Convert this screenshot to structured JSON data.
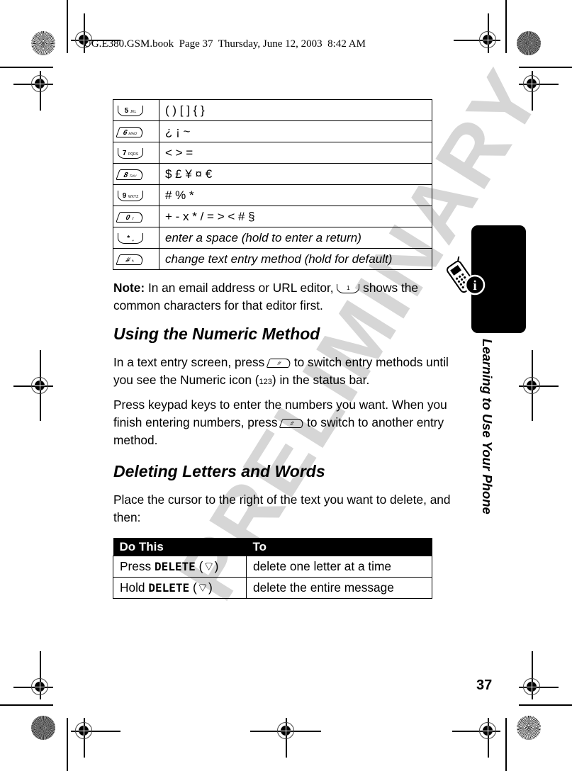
{
  "book_header": "UG.E380.GSM.book  Page 37  Thursday, June 12, 2003  8:42 AM",
  "watermark": "PRELIMINARY",
  "symbol_table": {
    "rows": [
      {
        "key_icon": "key-5-jkl-icon",
        "key_label": "5",
        "key_sub": "JKL",
        "value": "( ) [ ] { }",
        "italic": false
      },
      {
        "key_icon": "key-6-mno-icon",
        "key_label": "6",
        "key_sub": "MNO",
        "value": "¿ ¡ ~",
        "italic": false
      },
      {
        "key_icon": "key-7-pqrs-icon",
        "key_label": "7",
        "key_sub": "PQRS",
        "value": "< > =",
        "italic": false
      },
      {
        "key_icon": "key-8-tuv-icon",
        "key_label": "8",
        "key_sub": "TUV",
        "value": "$ £ ¥ ¤ €",
        "italic": false
      },
      {
        "key_icon": "key-9-wxyz-icon",
        "key_label": "9",
        "key_sub": "WXYZ",
        "value": "# % *",
        "italic": false
      },
      {
        "key_icon": "key-0-shift-icon",
        "key_label": "0",
        "key_sub": "⇧",
        "value": "+ - x * / = > < # §",
        "italic": false
      },
      {
        "key_icon": "key-star-space-icon",
        "key_label": "*",
        "key_sub": "␣",
        "value": "enter a space (hold to enter a return)",
        "italic": true
      },
      {
        "key_icon": "key-pound-mode-icon",
        "key_label": "#",
        "key_sub": "✎",
        "value": "change text entry method (hold for default)",
        "italic": true
      }
    ]
  },
  "note": {
    "label": "Note:",
    "text_before": " In an email address or URL editor, ",
    "key_label": "1",
    "text_after": " shows the common characters for that editor first."
  },
  "section1": {
    "heading": "Using the Numeric Method",
    "para1_before": "In a text entry screen, press ",
    "para1_middle": " to switch entry methods until you see the Numeric icon (",
    "numeric_icon": "123",
    "para1_after": ") in the status bar.",
    "para2_before": "Press keypad keys to enter the numbers you want. When you finish entering numbers, press ",
    "para2_after": " to switch to another entry method.",
    "key_label": "#"
  },
  "section2": {
    "heading": "Deleting Letters and Words",
    "para": "Place the cursor to the right of the text you want to delete, and then:"
  },
  "delete_table": {
    "headers": [
      "Do This",
      "To"
    ],
    "rows": [
      {
        "verb": "Press",
        "softkey": "DELETE",
        "key_glyph": "⌔",
        "result": "delete one letter at a time"
      },
      {
        "verb": "Hold",
        "softkey": "DELETE",
        "key_glyph": "⌔",
        "result": "delete the entire message"
      }
    ]
  },
  "side_tab": {
    "title": "Learning to Use Your Phone",
    "icon": "phone-info-icon"
  },
  "page_number": "37"
}
